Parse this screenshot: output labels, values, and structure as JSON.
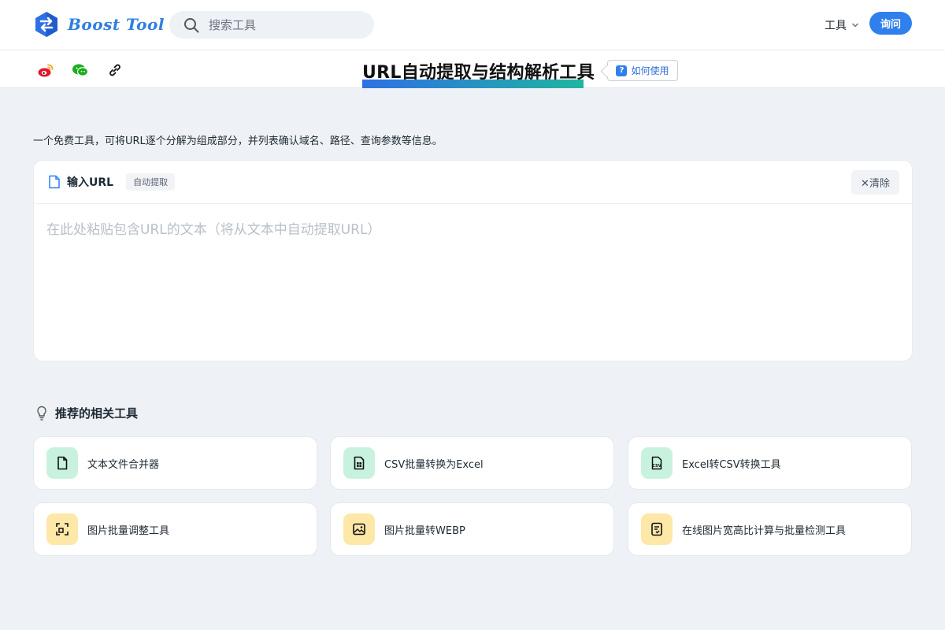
{
  "header": {
    "logo_text": "Boost Tool",
    "search_placeholder": "搜索工具",
    "tools_menu_label": "工具",
    "ask_button_label": "询问"
  },
  "subheader": {
    "share_icons": [
      "weibo-icon",
      "wechat-icon",
      "link-icon"
    ],
    "page_title": "URL自动提取与结构解析工具",
    "howto_label": "如何使用",
    "howto_badge": "?"
  },
  "main": {
    "description": "一个免费工具，可将URL逐个分解为组成部分，并列表确认域名、路径、查询参数等信息。",
    "input_card": {
      "label": "输入URL",
      "auto_tag": "自动提取",
      "clear_label": "✕清除",
      "placeholder": "在此处粘贴包含URL的文本（将从文本中自动提取URL）"
    }
  },
  "recommended": {
    "title": "推荐的相关工具",
    "tools": [
      {
        "name": "文本文件合并器",
        "icon": "file-icon",
        "color": "#c9f2de"
      },
      {
        "name": "CSV批量转换为Excel",
        "icon": "spreadsheet-icon",
        "color": "#c9f2de"
      },
      {
        "name": "Excel转CSV转换工具",
        "icon": "csv-file-icon",
        "color": "#c9f2de"
      },
      {
        "name": "图片批量调整工具",
        "icon": "resize-icon",
        "color": "#fde8a8"
      },
      {
        "name": "图片批量转WEBP",
        "icon": "image-icon",
        "color": "#fde8a8"
      },
      {
        "name": "在线图片宽高比计算与批量检测工具",
        "icon": "ratio-doc-icon",
        "color": "#fde8a8"
      }
    ]
  },
  "colors": {
    "accent": "#2f80ed",
    "page_bg": "#eef2f6",
    "title_gradient_start": "#2f6fe4",
    "title_gradient_end": "#1fb5a0"
  }
}
